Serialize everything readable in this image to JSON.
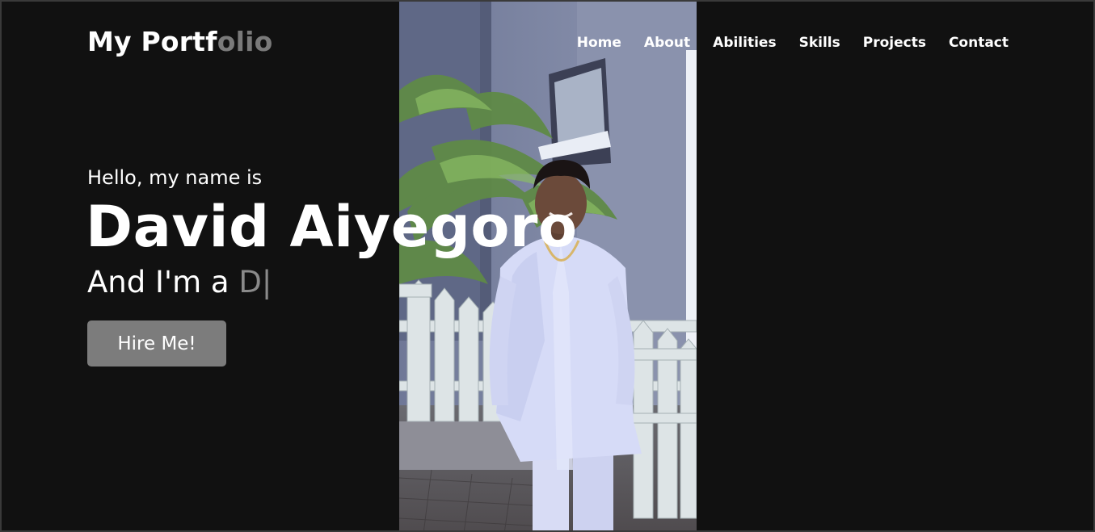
{
  "brand": {
    "part1": "My Portf",
    "part2": "olio"
  },
  "nav": {
    "items": [
      {
        "label": "Home"
      },
      {
        "label": "About"
      },
      {
        "label": "Abilities"
      },
      {
        "label": "Skills"
      },
      {
        "label": "Projects"
      },
      {
        "label": "Contact"
      }
    ]
  },
  "hero": {
    "greeting": "Hello, my name is",
    "name": "David Aiyegoro",
    "role_prefix": "And I'm a ",
    "role_typed": "D",
    "cursor": "|",
    "cta_label": "Hire Me!"
  },
  "colors": {
    "background": "#111111",
    "accent_gray": "#7a7a7a",
    "button": "#7c7c7c",
    "text": "#ffffff"
  }
}
